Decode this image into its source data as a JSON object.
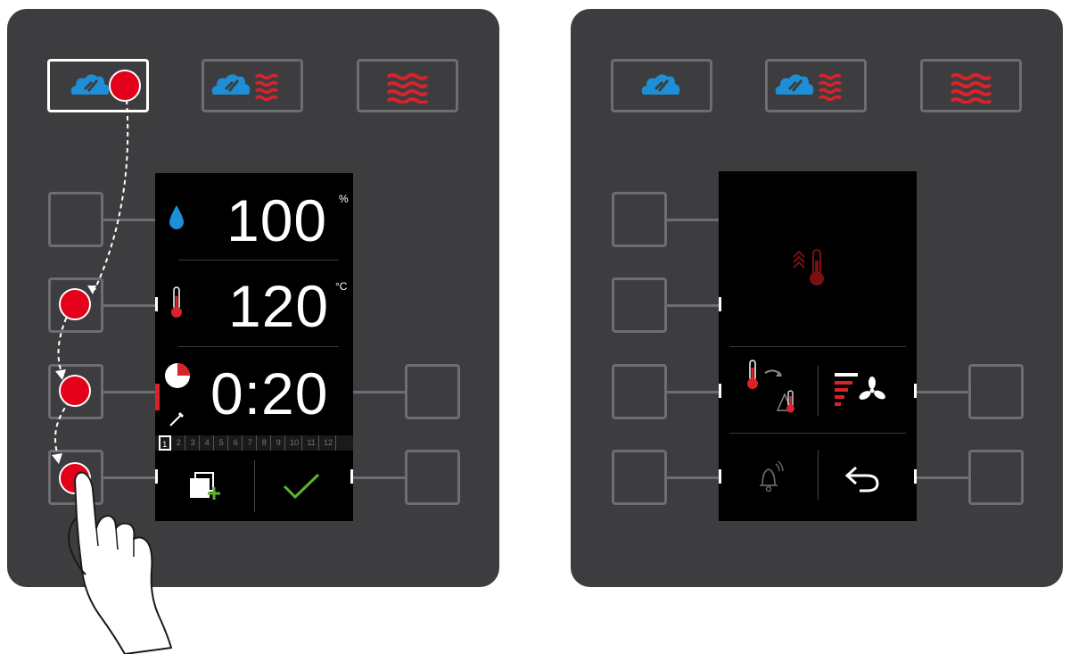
{
  "left_panel": {
    "humidity": {
      "value": "100",
      "unit": "%"
    },
    "temperature": {
      "value": "120",
      "unit": "°C"
    },
    "time": {
      "value": "0:20"
    },
    "step_numbers": [
      "1",
      "2",
      "3",
      "4",
      "5",
      "6",
      "7",
      "8",
      "9",
      "10",
      "11",
      "12"
    ],
    "active_step": "1"
  },
  "colors": {
    "panel": "#3d3d40",
    "button_border": "#6e6e72",
    "steam_blue": "#1e8fd6",
    "heat_red": "#d9222a",
    "touch_red": "#e3001b",
    "confirm_green": "#5fb32e"
  },
  "icons": [
    "steam-mode-icon",
    "combi-mode-icon",
    "hot-air-mode-icon",
    "water-drop-icon",
    "thermometer-icon",
    "timer-icon",
    "core-probe-icon",
    "add-step-icon",
    "confirm-check-icon",
    "preheat-icon",
    "cooldown-icon",
    "fan-speed-icon",
    "bell-icon",
    "back-arrow-icon",
    "hand-pointer-icon"
  ]
}
